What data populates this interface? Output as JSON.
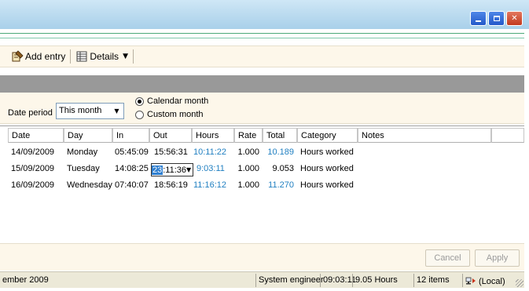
{
  "window": {
    "buttons": {
      "minimize": "minimize",
      "maximize": "maximize",
      "close": "close"
    }
  },
  "toolbar": {
    "add_entry_label": "Add entry",
    "details_label": "Details",
    "add_entry_icon": "add-entry-icon",
    "details_icon": "details-icon"
  },
  "filter": {
    "date_period_label": "Date period",
    "date_period_value": "This month",
    "radio_calendar": "Calendar month",
    "radio_custom": "Custom month",
    "selected": "calendar"
  },
  "table": {
    "columns": [
      "Date",
      "Day",
      "In",
      "Out",
      "Hours",
      "Rate",
      "Total",
      "Category",
      "Notes"
    ],
    "rows": [
      {
        "date": "14/09/2009",
        "day": "Monday",
        "in": "05:45:09",
        "out": "15:56:31",
        "hours": "10:11:22",
        "rate": "1.000",
        "total": "10.189",
        "category": "Hours worked",
        "notes": ""
      },
      {
        "date": "15/09/2009",
        "day": "Tuesday",
        "in": "14:08:25",
        "out": "23:11:36",
        "hours": "9:03:11",
        "rate": "1.000",
        "total": "9.053",
        "category": "Hours worked",
        "notes": ""
      },
      {
        "date": "16/09/2009",
        "day": "Wednesday",
        "in": "07:40:07",
        "out": "18:56:19",
        "hours": "11:16:12",
        "rate": "1.000",
        "total": "11.270",
        "category": "Hours worked",
        "notes": ""
      }
    ],
    "editing": {
      "selected_part": "23",
      "rest": ":11:36"
    }
  },
  "buttons": {
    "cancel": "Cancel",
    "apply": "Apply"
  },
  "status": {
    "period": "ember 2009",
    "job": "System engineer",
    "time": "09:03:11",
    "hours": "9.05 Hours",
    "items": "12 items",
    "location": "(Local)"
  },
  "colors": {
    "accent_blue": "#1f7fc1",
    "panel_bg": "#fdf7ea",
    "titlebar": "#bddcf0",
    "grey_band": "#999999"
  }
}
